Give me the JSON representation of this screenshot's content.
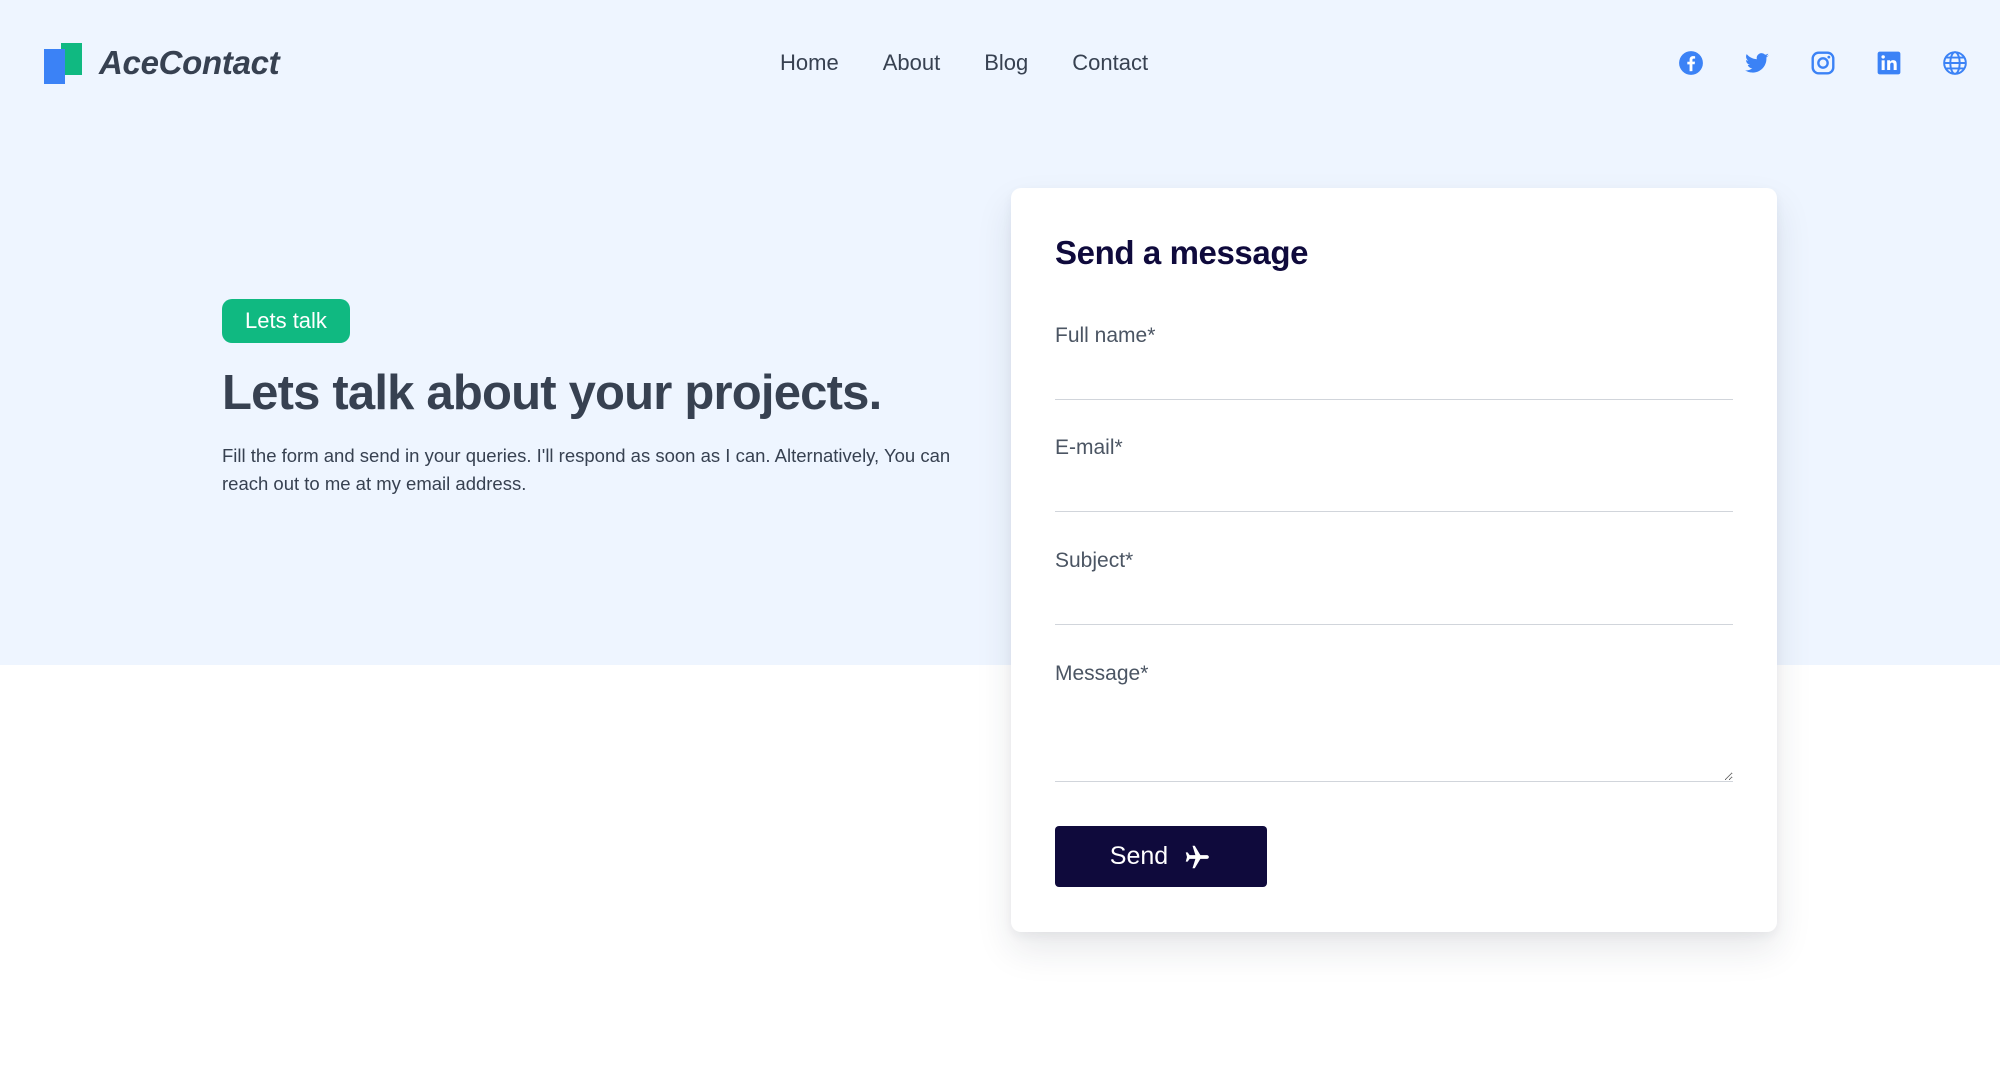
{
  "brand": {
    "name": "AceContact"
  },
  "nav": {
    "items": [
      {
        "label": "Home"
      },
      {
        "label": "About"
      },
      {
        "label": "Blog"
      },
      {
        "label": "Contact"
      }
    ]
  },
  "social": {
    "icons": [
      "facebook-icon",
      "twitter-icon",
      "instagram-icon",
      "linkedin-icon",
      "globe-icon"
    ],
    "color": "#3b82f6"
  },
  "hero": {
    "badge": "Lets talk",
    "title": "Lets talk about your projects.",
    "description": "Fill the form and send in your queries. I'll respond as soon as I can. Alternatively, You can reach out to me at my email address."
  },
  "form": {
    "title": "Send a message",
    "fields": [
      {
        "label": "Full name*",
        "value": ""
      },
      {
        "label": "E-mail*",
        "value": ""
      },
      {
        "label": "Subject*",
        "value": ""
      },
      {
        "label": "Message*",
        "value": ""
      }
    ],
    "submit_label": "Send",
    "submit_icon": "paper-plane-icon"
  },
  "colors": {
    "hero_background": "#eef5ff",
    "accent_green": "#10b981",
    "accent_blue": "#3b82f6",
    "button_navy": "#0f0a3c",
    "text": "#374151"
  }
}
